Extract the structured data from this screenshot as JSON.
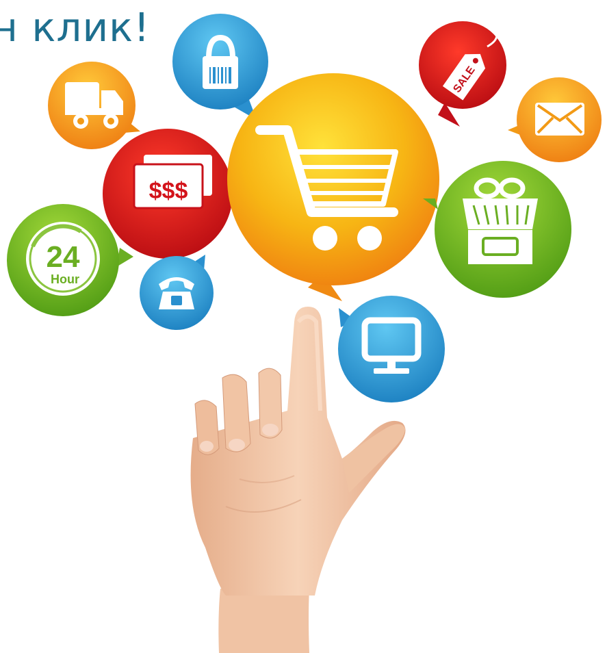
{
  "headline": "н клик!",
  "bubbles": {
    "money_label": "$$$",
    "hours_number": "24",
    "hours_label": "Hour",
    "sale_label": "SALE"
  },
  "colors": {
    "headline": "#1e6f8f",
    "blue": "#2a9bd6",
    "red": "#d8121a",
    "orange": "#f39a10",
    "yellow": "#f8c60e",
    "green": "#7cbf2a"
  }
}
